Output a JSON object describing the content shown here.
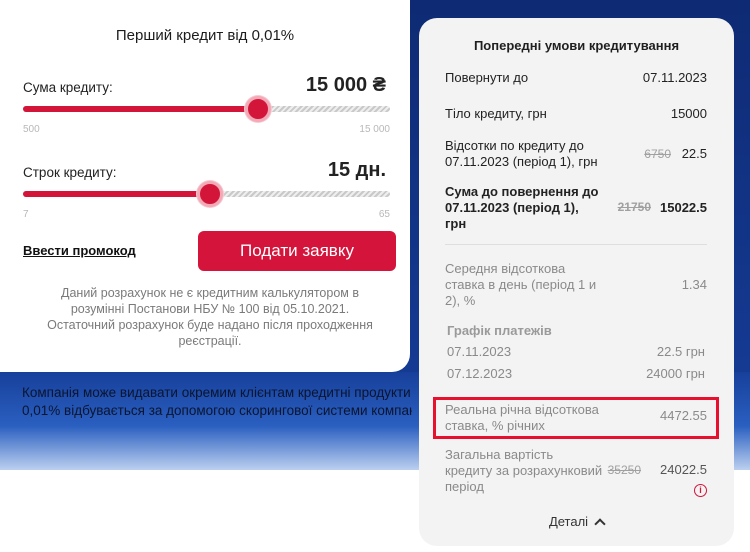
{
  "calculator": {
    "title": "Перший кредит від 0,01%",
    "amount": {
      "label": "Сума кредиту:",
      "value": "15 000 ₴",
      "min_label": "500",
      "max_label": "15 000",
      "fill_fraction": 0.64
    },
    "term": {
      "label": "Строк кредиту:",
      "value": "15 дн.",
      "min_label": "7",
      "max_label": "65",
      "fill_fraction": 0.51
    },
    "promo_link": "Ввести промокод",
    "submit_button": "Подати заявку",
    "disclaimer": "Даний розрахунок не є кредитним калькулятором в розумінні Постанови НБУ № 100 від 05.10.2021. Остаточний розрахунок буде надано після проходження реєстрації."
  },
  "company_text": {
    "line1": "Компанія може видавати окремим клієнтам кредитні продукти",
    "line2": "0,01% відбувається за допомогою скорингової системи компан"
  },
  "terms": {
    "title": "Попередні умови кредитування",
    "return_by": {
      "label": "Повернути до",
      "value": "07.11.2023"
    },
    "principal": {
      "label": "Тіло кредиту, грн",
      "value": "15000"
    },
    "interest": {
      "label_line1": "Відсотки по кредиту до",
      "label_line2": "07.11.2023 (період 1), грн",
      "old_value": "6750",
      "value": "22.5"
    },
    "total_return": {
      "label_line1": "Сума до повернення до",
      "label_line2": "07.11.2023 (період 1),",
      "label_line3": "грн",
      "old_value": "21750",
      "value": "15022.5"
    },
    "avg_rate": {
      "label_line1": "Середня відсоткова",
      "label_line2": "ставка в день (період 1 и",
      "label_line3": "2), %",
      "value": "1.34"
    },
    "schedule": {
      "title": "Графік платежів",
      "rows": [
        {
          "date": "07.11.2023",
          "amount": "22.5 грн"
        },
        {
          "date": "07.12.2023",
          "amount": "24000 грн"
        }
      ]
    },
    "real_rate": {
      "label_line1": "Реальна річна відсоткова",
      "label_line2": "ставка, % річних",
      "value": "4472.55"
    },
    "total_cost": {
      "label_line1": "Загальна вартість",
      "label_line2": "кредиту за розрахунковий",
      "label_line3": "період",
      "old_value": "35250",
      "value": "24022.5"
    },
    "details_toggle": "Деталі"
  },
  "colors": {
    "accent": "#d5143b",
    "highlight_border": "#e8112d",
    "background_blue": "#153a92"
  }
}
